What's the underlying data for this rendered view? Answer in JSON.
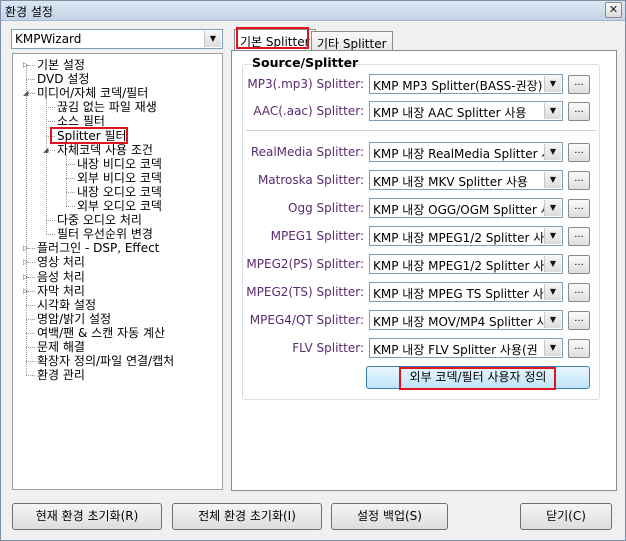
{
  "window": {
    "title": "환경 설정",
    "close_glyph": "✕"
  },
  "profile_combo": {
    "value": "KMPWizard"
  },
  "tree": [
    "기본 설정",
    "DVD 설정",
    "미디어/자체 코덱/필터",
    "끊김 없는 파일 재생",
    "소스 필터",
    "Splitter 필터",
    "자체코덱 사용 조건",
    "내장 비디오 코덱",
    "외부 비디오 코덱",
    "내장 오디오 코덱",
    "외부 오디오 코덱",
    "다중 오디오 처리",
    "필터 우선순위 변경",
    "플러그인 - DSP, Effect",
    "영상 처리",
    "음성 처리",
    "자막 처리",
    "시각화 설정",
    "명암/밝기 설정",
    "여백/팬 & 스캔 자동 계산",
    "문제 해결",
    "확장자 정의/파일 연결/캡처",
    "환경 관리"
  ],
  "tabs": [
    "기본 Splitter",
    "기타 Splitter"
  ],
  "group_title": "Source/Splitter",
  "rows": [
    {
      "label": "MP3(.mp3) Splitter:",
      "value": "KMP MP3 Splitter(BASS-권장)"
    },
    {
      "label": "AAC(.aac) Splitter:",
      "value": "KMP 내장 AAC Splitter 사용"
    },
    {
      "label": "RealMedia Splitter:",
      "value": "KMP 내장 RealMedia Splitter 사"
    },
    {
      "label": "Matroska Splitter:",
      "value": "KMP 내장 MKV Splitter 사용"
    },
    {
      "label": "Ogg Splitter:",
      "value": "KMP 내장 OGG/OGM Splitter 사"
    },
    {
      "label": "MPEG1 Splitter:",
      "value": "KMP 내장 MPEG1/2 Splitter 사"
    },
    {
      "label": "MPEG2(PS) Splitter:",
      "value": "KMP 내장 MPEG1/2 Splitter 사"
    },
    {
      "label": "MPEG2(TS) Splitter:",
      "value": "KMP 내장 MPEG TS Splitter 사"
    },
    {
      "label": "MPEG4/QT Splitter:",
      "value": "KMP 내장 MOV/MP4 Splitter 사"
    },
    {
      "label": "FLV Splitter:",
      "value": "KMP 내장 FLV Splitter 사용(권"
    }
  ],
  "dots_label": "...",
  "external_button": "외부 코덱/필터 사용자 정의",
  "bottom_buttons": [
    "현재 환경 초기화(R)",
    "전체 환경 초기화(I)",
    "설정 백업(S)",
    "닫기(C)"
  ],
  "colors": {
    "highlight": "#e0141e",
    "label_purple": "#5a2a6e",
    "accent_blue": "#3c7fb1"
  }
}
